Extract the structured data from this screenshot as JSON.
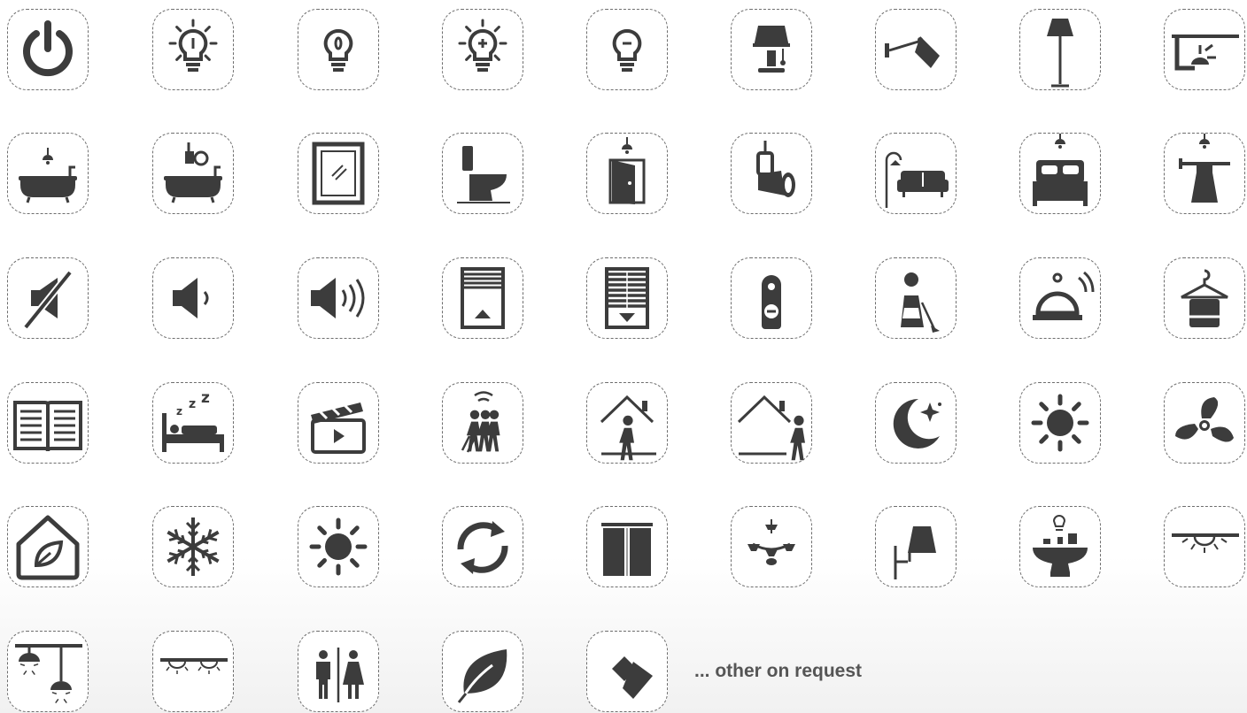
{
  "icon_color": "#3c3c3c",
  "footer": {
    "note": "... other on request"
  },
  "icons": [
    "power-icon",
    "light-bulb-dimmer-icon",
    "light-bulb-icon",
    "brightness-up-icon",
    "brightness-down-icon",
    "table-lamp-icon",
    "wall-spotlight-icon",
    "floor-lamp-icon",
    "ceiling-light-icon",
    "bathtub-pendant-icon",
    "bathtub-spotlight-icon",
    "mirror-icon",
    "toilet-icon",
    "door-light-icon",
    "spotlight-icon",
    "living-room-sofa-icon",
    "bedroom-bed-icon",
    "wardrobe-hanger-light-icon",
    "mute-icon",
    "volume-low-icon",
    "volume-high-icon",
    "blinds-up-icon",
    "blinds-down-icon",
    "do-not-disturb-icon",
    "housekeeping-icon",
    "service-bell-icon",
    "laundry-hanger-icon",
    "open-book-icon",
    "sleep-icon",
    "movie-clapper-icon",
    "motion-sensor-icon",
    "at-home-icon",
    "leave-home-icon",
    "night-mode-icon",
    "day-mode-icon",
    "fan-icon",
    "eco-home-icon",
    "snowflake-icon",
    "sun-icon",
    "refresh-icon",
    "curtains-icon",
    "chandelier-icon",
    "wall-lamp-icon",
    "dining-table-icon",
    "ceiling-downlight-icon",
    "pendant-lights-icon",
    "track-lights-icon",
    "restroom-icon",
    "leaf-icon",
    "projector-icon"
  ]
}
